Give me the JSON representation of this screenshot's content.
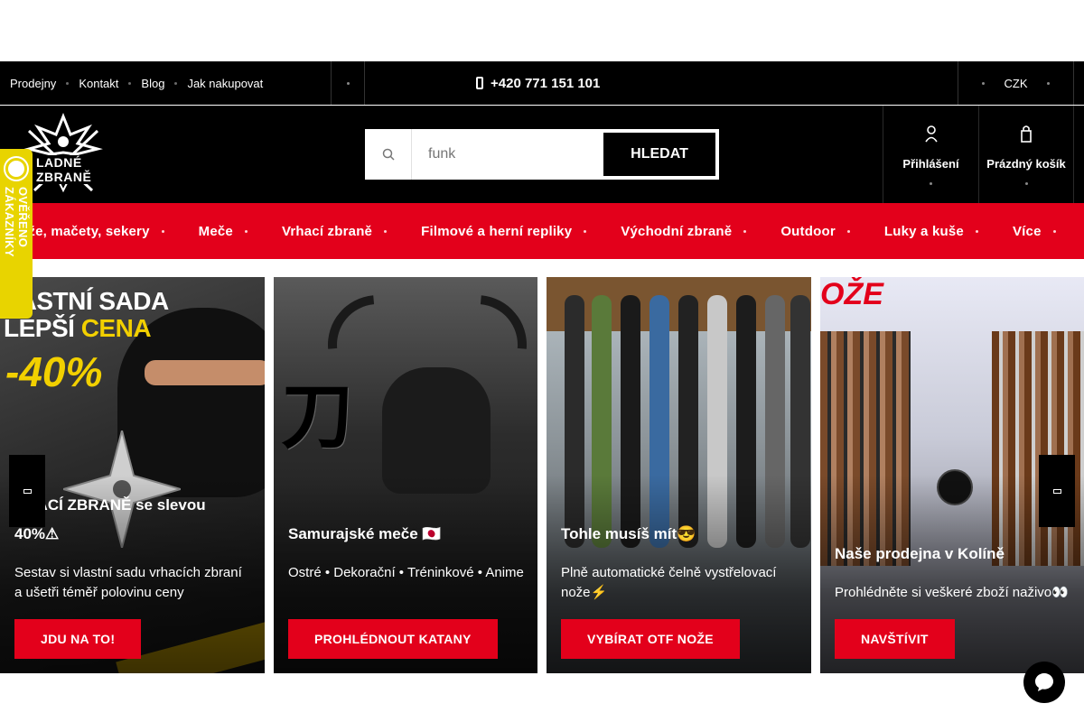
{
  "topbar": {
    "links": [
      "Prodejny",
      "Kontakt",
      "Blog",
      "Jak nakupovat"
    ],
    "phone": "+420 771 151 101",
    "currency": "CZK"
  },
  "header": {
    "logo_text": "LADNÉ ZBRANĚ",
    "search": {
      "value": "",
      "placeholder": "funk",
      "button": "HLEDAT"
    },
    "login_label": "Přihlášení",
    "cart_label": "Prázdný košík"
  },
  "badge": {
    "text": "OVĚŘENO ZÁKAZNÍKY"
  },
  "categories": [
    "ože, mačety, sekery",
    "Meče",
    "Vrhací zbraně",
    "Filmové a herní repliky",
    "Východní zbraně",
    "Outdoor",
    "Luky a kuše",
    "Více"
  ],
  "banners": [
    {
      "promo_1": "LASTNÍ SADA",
      "promo_2": "LEPŠÍ ",
      "promo_2b": "CENA",
      "promo_pct": "-40%",
      "title_line1": "RHACÍ ZBRANĚ se slevou",
      "title_line2": "40%⚠",
      "description": "Sestav si vlastní sadu vrhacích zbraní a ušetři téměř polovinu ceny",
      "button": "JDU NA TO!"
    },
    {
      "glyph": "刀",
      "title": "Samurajské meče 🇯🇵",
      "description": "Ostré • Dekorační • Tréninkové • Anime",
      "button": "PROHLÉDNOUT KATANY"
    },
    {
      "title": "Tohle musíš mít😎",
      "description": "Plně automatické čelně vystřelovací nože⚡",
      "button": "VYBÍRAT OTF NOŽE"
    },
    {
      "store_sign": "OŽE",
      "title": "Naše prodejna v Kolíně",
      "description": "Prohlédněte si veškeré zboží naživo👀",
      "button": "NAVŠTÍVIT"
    }
  ],
  "colors": {
    "accent_red": "#e3001b",
    "badge_yellow": "#e8d400",
    "black": "#000000"
  },
  "icons": [
    "phone-icon",
    "search-icon",
    "user-icon",
    "cart-icon",
    "chat-icon",
    "arrow-left-icon",
    "arrow-right-icon"
  ]
}
